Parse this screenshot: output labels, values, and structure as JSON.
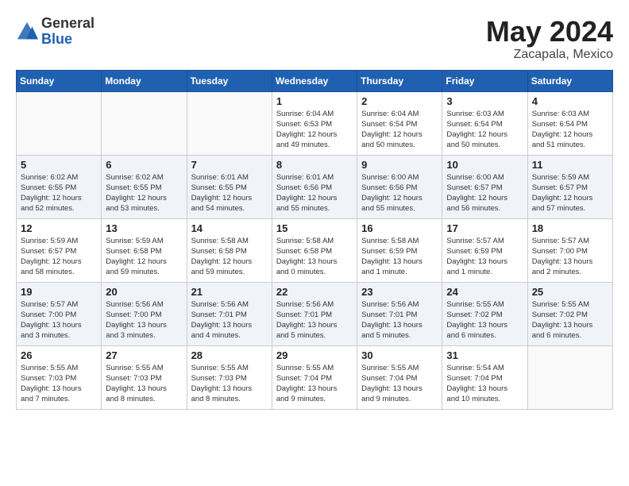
{
  "header": {
    "logo_general": "General",
    "logo_blue": "Blue",
    "month_title": "May 2024",
    "location": "Zacapala, Mexico"
  },
  "days_of_week": [
    "Sunday",
    "Monday",
    "Tuesday",
    "Wednesday",
    "Thursday",
    "Friday",
    "Saturday"
  ],
  "weeks": [
    [
      {
        "day": "",
        "info": ""
      },
      {
        "day": "",
        "info": ""
      },
      {
        "day": "",
        "info": ""
      },
      {
        "day": "1",
        "info": "Sunrise: 6:04 AM\nSunset: 6:53 PM\nDaylight: 12 hours\nand 49 minutes."
      },
      {
        "day": "2",
        "info": "Sunrise: 6:04 AM\nSunset: 6:54 PM\nDaylight: 12 hours\nand 50 minutes."
      },
      {
        "day": "3",
        "info": "Sunrise: 6:03 AM\nSunset: 6:54 PM\nDaylight: 12 hours\nand 50 minutes."
      },
      {
        "day": "4",
        "info": "Sunrise: 6:03 AM\nSunset: 6:54 PM\nDaylight: 12 hours\nand 51 minutes."
      }
    ],
    [
      {
        "day": "5",
        "info": "Sunrise: 6:02 AM\nSunset: 6:55 PM\nDaylight: 12 hours\nand 52 minutes."
      },
      {
        "day": "6",
        "info": "Sunrise: 6:02 AM\nSunset: 6:55 PM\nDaylight: 12 hours\nand 53 minutes."
      },
      {
        "day": "7",
        "info": "Sunrise: 6:01 AM\nSunset: 6:55 PM\nDaylight: 12 hours\nand 54 minutes."
      },
      {
        "day": "8",
        "info": "Sunrise: 6:01 AM\nSunset: 6:56 PM\nDaylight: 12 hours\nand 55 minutes."
      },
      {
        "day": "9",
        "info": "Sunrise: 6:00 AM\nSunset: 6:56 PM\nDaylight: 12 hours\nand 55 minutes."
      },
      {
        "day": "10",
        "info": "Sunrise: 6:00 AM\nSunset: 6:57 PM\nDaylight: 12 hours\nand 56 minutes."
      },
      {
        "day": "11",
        "info": "Sunrise: 5:59 AM\nSunset: 6:57 PM\nDaylight: 12 hours\nand 57 minutes."
      }
    ],
    [
      {
        "day": "12",
        "info": "Sunrise: 5:59 AM\nSunset: 6:57 PM\nDaylight: 12 hours\nand 58 minutes."
      },
      {
        "day": "13",
        "info": "Sunrise: 5:59 AM\nSunset: 6:58 PM\nDaylight: 12 hours\nand 59 minutes."
      },
      {
        "day": "14",
        "info": "Sunrise: 5:58 AM\nSunset: 6:58 PM\nDaylight: 12 hours\nand 59 minutes."
      },
      {
        "day": "15",
        "info": "Sunrise: 5:58 AM\nSunset: 6:58 PM\nDaylight: 13 hours\nand 0 minutes."
      },
      {
        "day": "16",
        "info": "Sunrise: 5:58 AM\nSunset: 6:59 PM\nDaylight: 13 hours\nand 1 minute."
      },
      {
        "day": "17",
        "info": "Sunrise: 5:57 AM\nSunset: 6:59 PM\nDaylight: 13 hours\nand 1 minute."
      },
      {
        "day": "18",
        "info": "Sunrise: 5:57 AM\nSunset: 7:00 PM\nDaylight: 13 hours\nand 2 minutes."
      }
    ],
    [
      {
        "day": "19",
        "info": "Sunrise: 5:57 AM\nSunset: 7:00 PM\nDaylight: 13 hours\nand 3 minutes."
      },
      {
        "day": "20",
        "info": "Sunrise: 5:56 AM\nSunset: 7:00 PM\nDaylight: 13 hours\nand 3 minutes."
      },
      {
        "day": "21",
        "info": "Sunrise: 5:56 AM\nSunset: 7:01 PM\nDaylight: 13 hours\nand 4 minutes."
      },
      {
        "day": "22",
        "info": "Sunrise: 5:56 AM\nSunset: 7:01 PM\nDaylight: 13 hours\nand 5 minutes."
      },
      {
        "day": "23",
        "info": "Sunrise: 5:56 AM\nSunset: 7:01 PM\nDaylight: 13 hours\nand 5 minutes."
      },
      {
        "day": "24",
        "info": "Sunrise: 5:55 AM\nSunset: 7:02 PM\nDaylight: 13 hours\nand 6 minutes."
      },
      {
        "day": "25",
        "info": "Sunrise: 5:55 AM\nSunset: 7:02 PM\nDaylight: 13 hours\nand 6 minutes."
      }
    ],
    [
      {
        "day": "26",
        "info": "Sunrise: 5:55 AM\nSunset: 7:03 PM\nDaylight: 13 hours\nand 7 minutes."
      },
      {
        "day": "27",
        "info": "Sunrise: 5:55 AM\nSunset: 7:03 PM\nDaylight: 13 hours\nand 8 minutes."
      },
      {
        "day": "28",
        "info": "Sunrise: 5:55 AM\nSunset: 7:03 PM\nDaylight: 13 hours\nand 8 minutes."
      },
      {
        "day": "29",
        "info": "Sunrise: 5:55 AM\nSunset: 7:04 PM\nDaylight: 13 hours\nand 9 minutes."
      },
      {
        "day": "30",
        "info": "Sunrise: 5:55 AM\nSunset: 7:04 PM\nDaylight: 13 hours\nand 9 minutes."
      },
      {
        "day": "31",
        "info": "Sunrise: 5:54 AM\nSunset: 7:04 PM\nDaylight: 13 hours\nand 10 minutes."
      },
      {
        "day": "",
        "info": ""
      }
    ]
  ]
}
